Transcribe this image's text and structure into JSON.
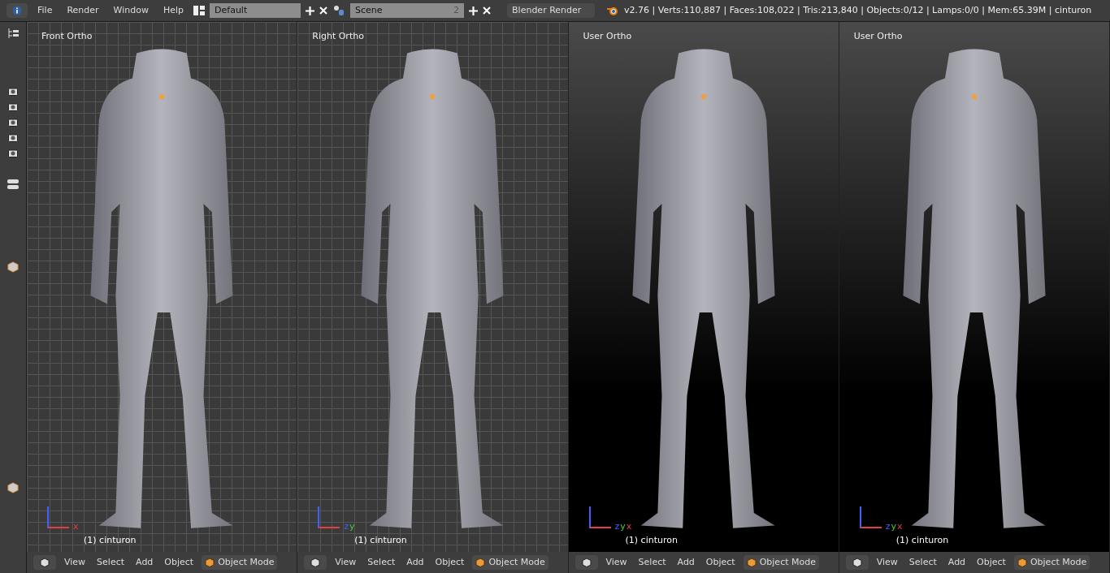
{
  "topbar": {
    "menus": [
      "File",
      "Render",
      "Window",
      "Help"
    ],
    "layout": "Default",
    "scene": "Scene",
    "scene_users": "2",
    "engine": "Blender Render",
    "stats": "v2.76 | Verts:110,887 | Faces:108,022 | Tris:213,840 | Objects:0/12 | Lamps:0/0 | Mem:65.39M | cinturon"
  },
  "viewports": [
    {
      "title": "Front Ortho",
      "kind": "grid",
      "axes": [
        "x"
      ],
      "object_label": "(1) cinturon",
      "menus": [
        "View",
        "Select",
        "Add",
        "Object"
      ],
      "mode": "Object Mode"
    },
    {
      "title": "Right Ortho",
      "kind": "grid",
      "axes": [
        "z",
        "y"
      ],
      "object_label": "(1) cinturon",
      "menus": [
        "View",
        "Select",
        "Add",
        "Object"
      ],
      "mode": "Object Mode"
    },
    {
      "title": "User Ortho",
      "kind": "gradient",
      "axes": [
        "z",
        "y",
        "x"
      ],
      "object_label": "(1) cinturon",
      "menus": [
        "View",
        "Select",
        "Add",
        "Object"
      ],
      "mode": "Object Mode"
    },
    {
      "title": "User Ortho",
      "kind": "gradient",
      "axes": [
        "z",
        "y",
        "x"
      ],
      "object_label": "(1) cinturon",
      "menus": [
        "View",
        "Select",
        "Add",
        "Object"
      ],
      "mode": "Object Mode"
    }
  ]
}
